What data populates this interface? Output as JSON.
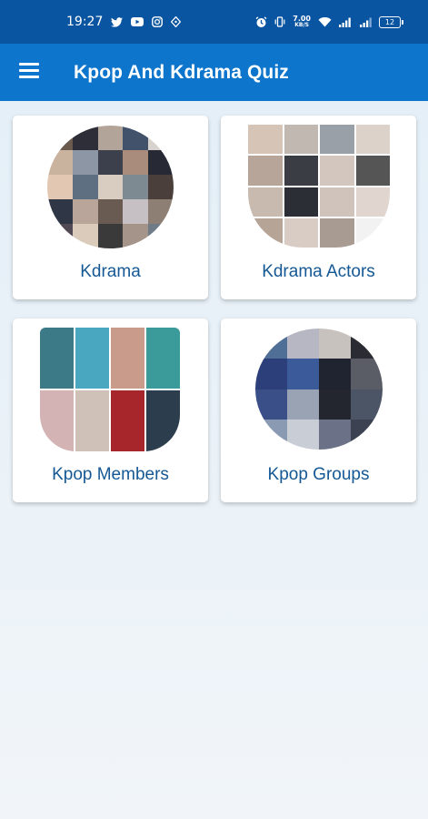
{
  "status_bar": {
    "time": "19:27",
    "net_speed_value": "7.00",
    "net_speed_unit": "KB/S",
    "battery_level": "12",
    "icons": [
      "twitter-icon",
      "youtube-icon",
      "instagram-icon",
      "location-icon",
      "alarm-icon",
      "vibrate-icon",
      "wifi-icon",
      "signal-icon",
      "signal-icon-2",
      "battery-icon"
    ]
  },
  "app_bar": {
    "title": "Kpop And Kdrama Quiz",
    "menu_icon": "hamburger-menu-icon"
  },
  "categories": [
    {
      "label": "Kdrama"
    },
    {
      "label": "Kdrama Actors"
    },
    {
      "label": "Kpop Members"
    },
    {
      "label": "Kpop Groups"
    }
  ],
  "colors": {
    "status_bar": "#0a55a1",
    "app_bar": "#0d75cc",
    "card_label": "#155894",
    "background": "#e3eef7"
  }
}
